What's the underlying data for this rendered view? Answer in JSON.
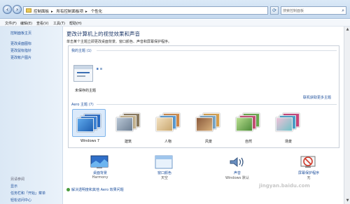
{
  "address_bar": {
    "crumbs": [
      "控制面板",
      "所有控制面板项",
      "个性化"
    ],
    "search_placeholder": "搜索控制面板"
  },
  "menu": [
    "文件(F)",
    "编辑(E)",
    "查看(V)",
    "工具(T)",
    "帮助(H)"
  ],
  "leftnav": {
    "home": "控制面板主页",
    "links": [
      "更改桌面图标",
      "更改鼠标指针",
      "更改帐户图片"
    ],
    "see_also_title": "另请参阅",
    "see_also": [
      "显示",
      "任务栏和「开始」菜单",
      "轻松访问中心"
    ]
  },
  "main": {
    "heading": "更改计算机上的视觉效果和声音",
    "subheading": "单击某个主题立即更改桌面背景、窗口颜色、声音和屏幕保护程序。",
    "my_themes_title": "我的主题 (1)",
    "my_theme_label": "未保存的主题",
    "online_link": "联机获取更多主题",
    "aero_title": "Aero 主题 (7)",
    "themes": [
      "Windows 7",
      "建筑",
      "人物",
      "风景",
      "自然",
      "场景"
    ],
    "options": [
      {
        "name": "桌面背景",
        "sub": "Harmony"
      },
      {
        "name": "窗口颜色",
        "sub": "天空"
      },
      {
        "name": "声音",
        "sub": "Windows 默认"
      },
      {
        "name": "屏幕保护程序",
        "sub": "无"
      }
    ],
    "troubleshoot": "解决透明度和其他 Aero 效果问题"
  },
  "watermark": "jingyan.baidu.com",
  "colors": {
    "link": "#1d4f9c",
    "selection": "#dbeafb",
    "nav_bg": "#dbe8f5"
  }
}
